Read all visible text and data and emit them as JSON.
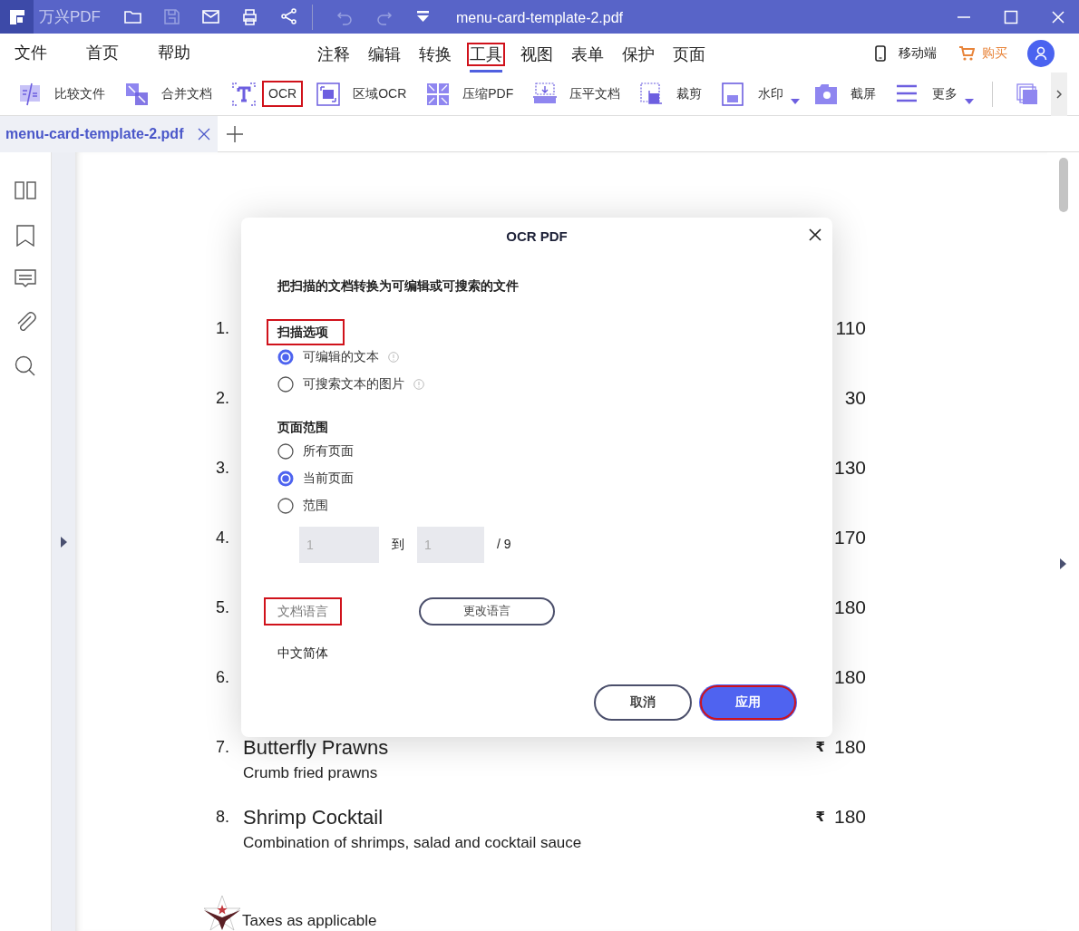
{
  "title_bar": {
    "app_name": "万兴PDF",
    "document_title": "menu-card-template-2.pdf",
    "quick_actions": [
      {
        "kind": "folder",
        "disabled": false
      },
      {
        "kind": "save",
        "disabled": true
      },
      {
        "kind": "mail",
        "disabled": false
      },
      {
        "kind": "print",
        "disabled": false
      },
      {
        "kind": "share",
        "disabled": false
      },
      {
        "kind": "undo",
        "disabled": true
      },
      {
        "kind": "redo",
        "disabled": true
      },
      {
        "kind": "customize",
        "disabled": false
      }
    ]
  },
  "menu": {
    "left": [
      "文件",
      "首页",
      "帮助"
    ],
    "tabs": [
      {
        "label": "注释",
        "selected": false,
        "highlighted": false
      },
      {
        "label": "编辑",
        "selected": false,
        "highlighted": false
      },
      {
        "label": "转换",
        "selected": false,
        "highlighted": false
      },
      {
        "label": "工具",
        "selected": true,
        "highlighted": true
      },
      {
        "label": "视图",
        "selected": false,
        "highlighted": false
      },
      {
        "label": "表单",
        "selected": false,
        "highlighted": false
      },
      {
        "label": "保护",
        "selected": false,
        "highlighted": false
      },
      {
        "label": "页面",
        "selected": false,
        "highlighted": false
      }
    ],
    "mobile": "移动端",
    "buy": "购买"
  },
  "toolbar": [
    {
      "kind": "compare",
      "label": "比较文件",
      "dropdown": false,
      "highlighted": false
    },
    {
      "kind": "merge",
      "label": "合并文档",
      "dropdown": false,
      "highlighted": false
    },
    {
      "kind": "ocr",
      "label": "OCR",
      "dropdown": false,
      "highlighted": true
    },
    {
      "kind": "area-ocr",
      "label": "区域OCR",
      "dropdown": false,
      "highlighted": false
    },
    {
      "kind": "compress",
      "label": "压缩PDF",
      "dropdown": false,
      "highlighted": false
    },
    {
      "kind": "flatten",
      "label": "压平文档",
      "dropdown": false,
      "highlighted": false
    },
    {
      "kind": "crop",
      "label": "裁剪",
      "dropdown": false,
      "highlighted": false
    },
    {
      "kind": "watermark",
      "label": "水印",
      "dropdown": true,
      "highlighted": false
    },
    {
      "kind": "screenshot",
      "label": "截屏",
      "dropdown": false,
      "highlighted": false
    },
    {
      "kind": "more",
      "label": "更多",
      "dropdown": true,
      "highlighted": false
    }
  ],
  "document_tabs": [
    {
      "label": "menu-card-template-2.pdf",
      "selected": true
    }
  ],
  "document": {
    "items": [
      {
        "number": "1.",
        "price": "110"
      },
      {
        "number": "2.",
        "price": "30"
      },
      {
        "number": "3.",
        "price": "130"
      },
      {
        "number": "4.",
        "price": "170"
      },
      {
        "number": "5.",
        "price": "180"
      },
      {
        "number": "6.",
        "price": "180"
      },
      {
        "number": "7.",
        "name": "Butterfly Prawns",
        "description": "Crumb fried prawns",
        "currency": "₹",
        "price": "180"
      },
      {
        "number": "8.",
        "name": "Shrimp Cocktail",
        "description": "Combination of shrimps, salad and cocktail sauce",
        "currency": "₹",
        "price": "180"
      }
    ],
    "footnote": "Taxes as applicable"
  },
  "dialog": {
    "title": "OCR PDF",
    "subtitle": "把扫描的文档转换为可编辑或可搜索的文件",
    "scan_options": {
      "heading": "扫描选项",
      "highlighted": true,
      "options": [
        {
          "label": "可编辑的文本",
          "selected": true,
          "info": true
        },
        {
          "label": "可搜索文本的图片",
          "selected": false,
          "info": true
        }
      ]
    },
    "page_range": {
      "heading": "页面范围",
      "options": [
        {
          "label": "所有页面",
          "selected": false
        },
        {
          "label": "当前页面",
          "selected": true
        },
        {
          "label": "范围",
          "selected": false
        }
      ],
      "from": {
        "value": "1",
        "disabled": true
      },
      "to_label": "到",
      "to": {
        "value": "1",
        "disabled": true
      },
      "total": "/ 9"
    },
    "language": {
      "label": "文档语言",
      "highlighted": true,
      "change_button": "更改语言",
      "value": "中文简体"
    },
    "buttons": [
      {
        "label": "取消",
        "kind": "secondary",
        "highlighted": false
      },
      {
        "label": "应用",
        "kind": "primary",
        "highlighted": true
      }
    ]
  }
}
